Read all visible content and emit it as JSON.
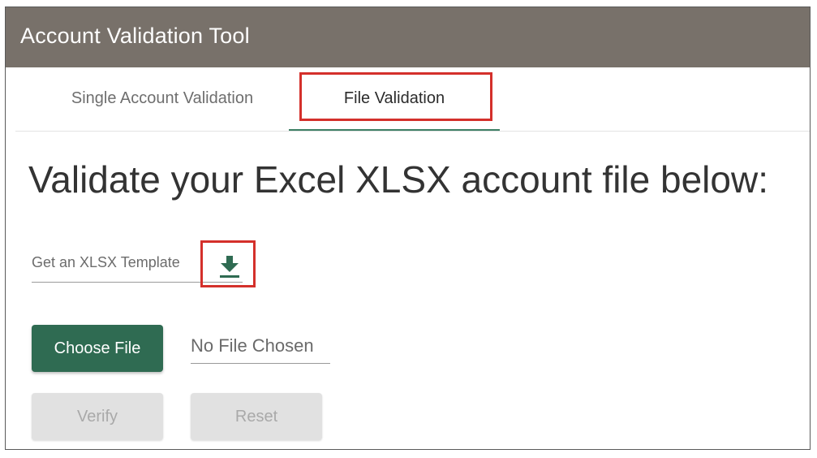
{
  "app": {
    "title": "Account Validation Tool"
  },
  "tabs": [
    {
      "label": "Single Account Validation",
      "active": false
    },
    {
      "label": "File Validation",
      "active": true
    }
  ],
  "main": {
    "headline": "Validate your Excel XLSX account file below:",
    "template_label": "Get an XLSX Template",
    "download_icon": "download-icon",
    "choose_file_label": "Choose File",
    "file_status": "No File Chosen",
    "verify_label": "Verify",
    "reset_label": "Reset"
  },
  "colors": {
    "titlebar": "#78716a",
    "accent_green": "#2f6b52",
    "highlight_red": "#d4302b",
    "disabled_bg": "#e1e1e1"
  }
}
